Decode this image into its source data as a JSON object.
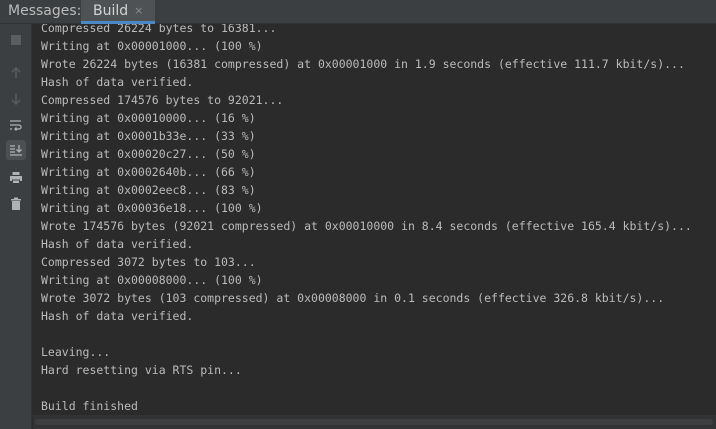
{
  "panel": {
    "title": "Messages:",
    "tabs": [
      {
        "label": "Build",
        "close_glyph": "×"
      }
    ]
  },
  "toolbar": {
    "icons": [
      "stop-icon",
      "arrow-up-icon",
      "arrow-down-icon",
      "soft-wrap-icon",
      "scroll-to-end-icon",
      "print-icon",
      "trash-icon"
    ]
  },
  "console": {
    "lines": [
      "Compressed 26224 bytes to 16381...",
      "Writing at 0x00001000... (100 %)",
      "Wrote 26224 bytes (16381 compressed) at 0x00001000 in 1.9 seconds (effective 111.7 kbit/s)...",
      "Hash of data verified.",
      "Compressed 174576 bytes to 92021...",
      "Writing at 0x00010000... (16 %)",
      "Writing at 0x0001b33e... (33 %)",
      "Writing at 0x00020c27... (50 %)",
      "Writing at 0x0002640b... (66 %)",
      "Writing at 0x0002eec8... (83 %)",
      "Writing at 0x00036e18... (100 %)",
      "Wrote 174576 bytes (92021 compressed) at 0x00010000 in 8.4 seconds (effective 165.4 kbit/s)...",
      "Hash of data verified.",
      "Compressed 3072 bytes to 103...",
      "Writing at 0x00008000... (100 %)",
      "Wrote 3072 bytes (103 compressed) at 0x00008000 in 0.1 seconds (effective 326.8 kbit/s)...",
      "Hash of data verified.",
      "",
      "Leaving...",
      "Hard resetting via RTS pin...",
      "",
      "Build finished"
    ]
  },
  "colors": {
    "background": "#2b2b2b",
    "toolbar": "#3c3f41",
    "text": "#bbbbbb",
    "tab_accent": "#4a88c7"
  }
}
